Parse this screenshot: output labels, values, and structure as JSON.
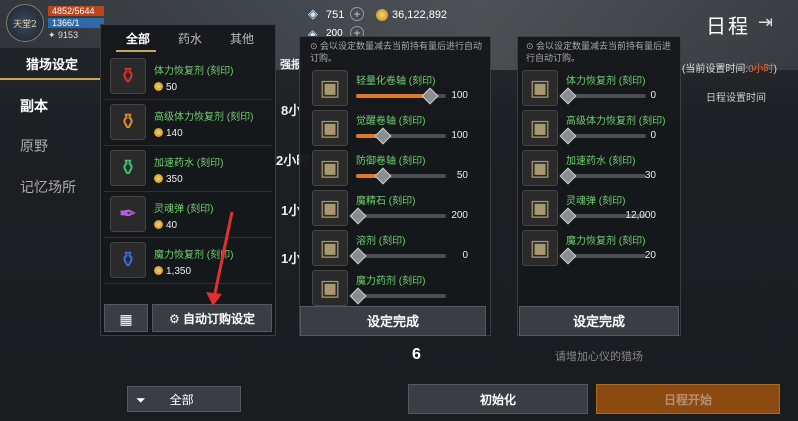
{
  "status": {
    "logo": "天堂2",
    "hp": "4852/5644",
    "mp": "1366/1",
    "gold": "9153"
  },
  "currency": {
    "diamond": "751",
    "gold": "36,122,892",
    "gem2": "200"
  },
  "nav": {
    "hunt_tab": "猎场设定",
    "items": [
      "副本",
      "原野",
      "记忆场所"
    ]
  },
  "bg_texts": [
    "8小",
    "2小时",
    "1小",
    "1小"
  ],
  "bg_label": "强报",
  "schedule": {
    "title": "日程",
    "current_prefix": "(当前设置时间:",
    "current_value": "0小时",
    "current_suffix": ")",
    "setting_time": "日程设置时间"
  },
  "panel1": {
    "tabs": [
      "全部",
      "药水",
      "其他"
    ],
    "items": [
      {
        "name": "体力恢复剂 (刻印)",
        "price": "50",
        "icon": "red-potion-icon"
      },
      {
        "name": "高级体力恢复剂 (刻印)",
        "price": "140",
        "icon": "orange-potion-icon"
      },
      {
        "name": "加速药水 (刻印)",
        "price": "350",
        "icon": "green-potion-icon"
      },
      {
        "name": "灵魂弹 (刻印)",
        "price": "40",
        "icon": "soulshot-icon"
      },
      {
        "name": "魔力恢复剂 (刻印)",
        "price": "1,350",
        "icon": "blue-potion-icon"
      }
    ],
    "auto_button": "自动订购设定"
  },
  "panel2": {
    "note": "会以设定数量减去当前持有量后进行自动订购。",
    "items": [
      {
        "name": "轻量化卷轴 (刻印)",
        "value": "100",
        "level": 0.8
      },
      {
        "name": "觉醒卷轴 (刻印)",
        "value": "100",
        "level": 0.28
      },
      {
        "name": "防御卷轴 (刻印)",
        "value": "50",
        "level": 0.28
      },
      {
        "name": "魔精石 (刻印)",
        "value": "200",
        "level": 0.0
      },
      {
        "name": "溶剂 (刻印)",
        "value": "0",
        "level": 0.0
      },
      {
        "name": "魔力药剂 (刻印)",
        "value": "",
        "level": 0.0
      }
    ],
    "done_button": "设定完成"
  },
  "panel3": {
    "note": "会以设定数量减去当前持有量后进行自动订购。",
    "items": [
      {
        "name": "体力恢复剂 (刻印)",
        "value": "0",
        "level": 0.0
      },
      {
        "name": "高级体力恢复剂 (刻印)",
        "value": "0",
        "level": 0.0
      },
      {
        "name": "加速药水 (刻印)",
        "value": "30",
        "level": 0.0
      },
      {
        "name": "灵魂弹 (刻印)",
        "value": "12,000",
        "level": 0.0
      },
      {
        "name": "魔力恢复剂 (刻印)",
        "value": "20",
        "level": 0.0
      }
    ],
    "done_button": "设定完成"
  },
  "bottom": {
    "count": "6",
    "hint": "请增加心仪的猎场",
    "filter": "全部",
    "init": "初始化",
    "start": "日程开始"
  },
  "colors": {
    "accent": "#c8a656",
    "item_name": "#6fcf6f",
    "highlight": "#ff6a30",
    "arrow": "#e03030"
  }
}
